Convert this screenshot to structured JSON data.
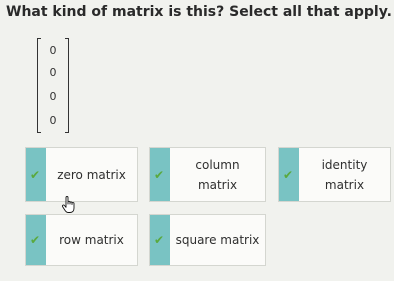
{
  "question": {
    "text": "What kind of matrix is this? Select all that apply."
  },
  "matrix": {
    "entries": [
      "0",
      "0",
      "0",
      "0"
    ]
  },
  "choices": [
    {
      "label": "zero matrix",
      "check_icon": "check-icon"
    },
    {
      "label": "column\nmatrix",
      "check_icon": "check-icon"
    },
    {
      "label": "identity\nmatrix",
      "check_icon": "check-icon"
    },
    {
      "label": "row matrix",
      "check_icon": "check-icon"
    },
    {
      "label": "square matrix",
      "check_icon": "check-icon"
    }
  ],
  "colors": {
    "stripe": "#79c3c3",
    "check": "#5aa93e",
    "background": "#f1f2ee"
  }
}
